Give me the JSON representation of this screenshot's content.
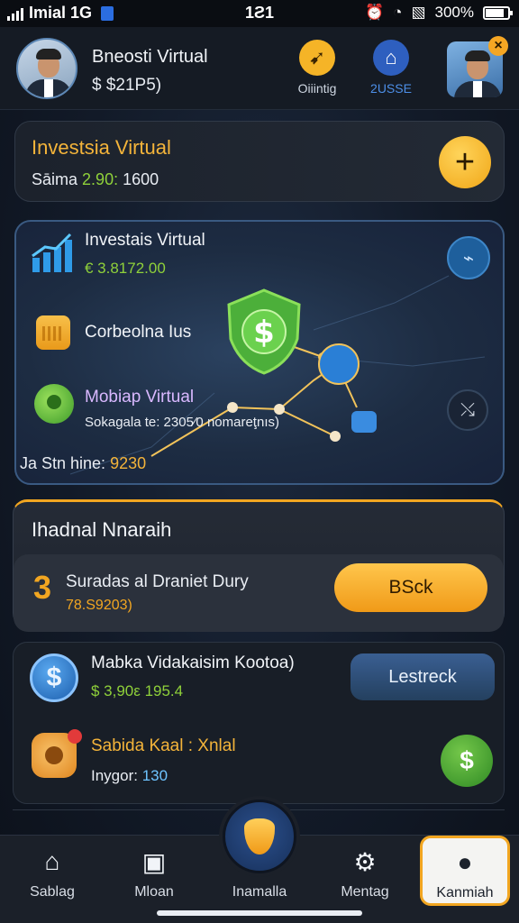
{
  "status_bar": {
    "carrier": "Imial 1G",
    "time": "1Ƨ1",
    "battery": "300%"
  },
  "header": {
    "user_name": "Bneosti Virtual",
    "user_balance": "$ $21P5)",
    "rating_label": "Oiiintig",
    "profile_label": "2USSE",
    "close_symbol": "×"
  },
  "invest_card": {
    "title": "Investsia Virtual",
    "balance_prefix": "Sāima",
    "balance_value": "2.90:",
    "balance_extra": "1600",
    "add_symbol": "+"
  },
  "network_card": {
    "title": "Investais Virtual",
    "amount": "€ 3.8172.00",
    "label_1": "Corbeolna Ius",
    "label_2": "Mobiap Virtual",
    "sub_label": "Sokagala te: 2305⁄0 nomareţnıs)",
    "footer_prefix": "Ja Stn hine:",
    "footer_value": "9230",
    "shield_symbol": "$"
  },
  "featured_card": {
    "title": "Ihadnal Nnaraih",
    "number": "3",
    "description": "Suradas al Draniet Dury",
    "value": "78.S9203)",
    "back_button": "BSck"
  },
  "list": {
    "item_1_title": "Mabka Vidakaisim Kootoa)",
    "item_1_value": "$ 3,90ε 195.4",
    "item_1_button": "Lestreck",
    "item_2_title": "Sabida Kaal : Xnlal",
    "item_2_prefix": "Inygor:",
    "item_2_value": "130",
    "dollar_symbol": "$"
  },
  "nav": {
    "home": "Sablag",
    "book": "Mloan",
    "center": "Inamalla",
    "menu": "Mentag",
    "active": "Kanmiah"
  },
  "colors": {
    "accent": "#f2a621",
    "positive": "#8fd13a",
    "background": "#121a28"
  },
  "icons": [
    "signal-icon",
    "sim-icon",
    "alarm-icon",
    "wifi-icon",
    "battery-icon",
    "rating-icon",
    "profile-icon",
    "chart-icon",
    "calendar-icon",
    "bulb-icon",
    "shield-icon",
    "satellite-icon",
    "share-icon",
    "dollar-icon",
    "gear-icon",
    "home-icon",
    "book-icon",
    "menu-icon",
    "bear-icon"
  ]
}
